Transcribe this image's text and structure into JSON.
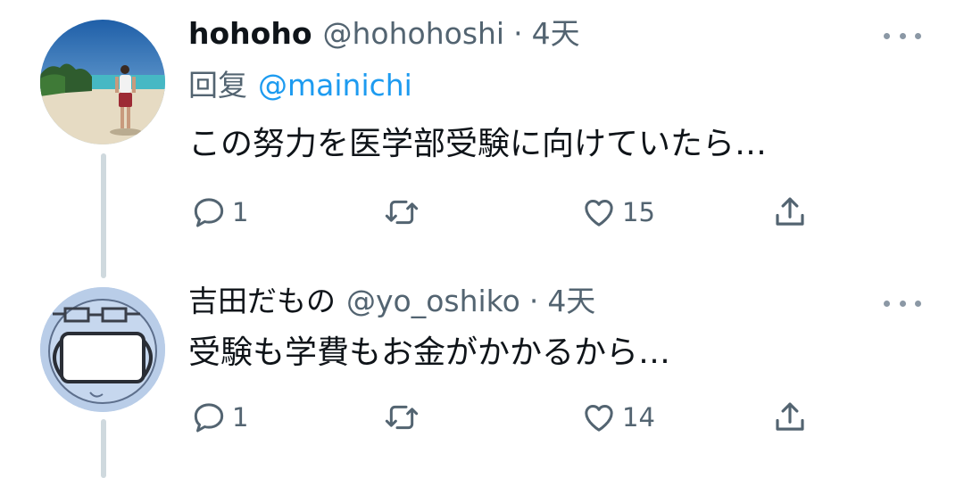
{
  "tweets": [
    {
      "display_name": "hohoho",
      "handle": "@hohohoshi",
      "separator": "·",
      "time": "4天",
      "reply_prefix": "回复",
      "reply_handle": "@mainichi",
      "text": "この努力を医学部受験に向けていたら…",
      "avatar_icon": "beach-photo",
      "actions": {
        "reply_count": "1",
        "retweet_count": "",
        "like_count": "15"
      }
    },
    {
      "display_name": "吉田だもの",
      "handle": "@yo_oshiko",
      "separator": "·",
      "time": "4天",
      "text": "受験も学費もお金がかかるから…",
      "avatar_icon": "masked-face-drawing",
      "actions": {
        "reply_count": "1",
        "retweet_count": "",
        "like_count": "14"
      }
    }
  ],
  "colors": {
    "text_primary": "#0f1419",
    "text_secondary": "#536471",
    "link": "#1d9bf0",
    "thread_line": "#cfd9de"
  }
}
